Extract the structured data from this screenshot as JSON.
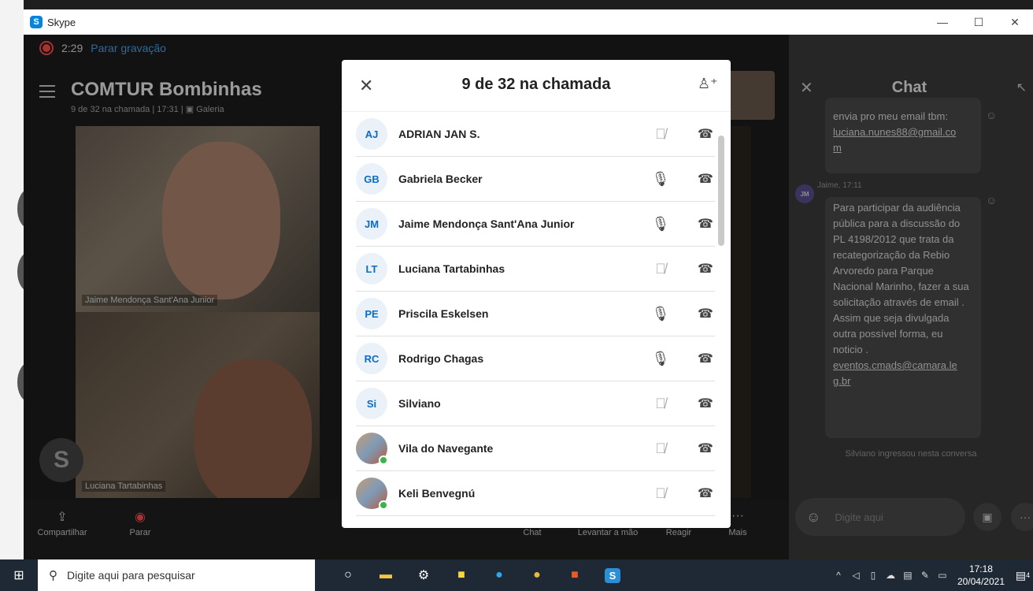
{
  "window": {
    "app_title": "Skype"
  },
  "recording": {
    "time": "2:29",
    "stop_label": "Parar gravação"
  },
  "call": {
    "title": "COMTUR Bombinhas",
    "subtitle": "9 de 32 na chamada | 17:31 | ▣ Galeria",
    "video_labels": [
      "Jaime Mendonça Sant'Ana Junior",
      "Luciana Tartabinhas"
    ],
    "controls": [
      {
        "label": "Compartilhar",
        "icon": "share-icon"
      },
      {
        "label": "Parar",
        "icon": "record-stop-icon"
      },
      {
        "label": "Chat",
        "icon": "chat-icon"
      },
      {
        "label": "Levantar a mão",
        "icon": "hand-icon"
      },
      {
        "label": "Reagir",
        "icon": "react-icon"
      },
      {
        "label": "Mais",
        "icon": "more-icon"
      }
    ]
  },
  "modal": {
    "title": "9 de 32 na chamada",
    "participants": [
      {
        "initials": "AJ",
        "name": "ADRIAN JAN S.",
        "muted": true,
        "photo": false,
        "online": false
      },
      {
        "initials": "GB",
        "name": "Gabriela Becker",
        "muted": false,
        "photo": false,
        "online": false
      },
      {
        "initials": "JM",
        "name": "Jaime Mendonça Sant'Ana Junior",
        "muted": false,
        "photo": false,
        "online": false
      },
      {
        "initials": "LT",
        "name": "Luciana Tartabinhas",
        "muted": true,
        "photo": false,
        "online": false
      },
      {
        "initials": "PE",
        "name": "Priscila Eskelsen",
        "muted": false,
        "photo": false,
        "online": false
      },
      {
        "initials": "RC",
        "name": "Rodrigo Chagas",
        "muted": false,
        "photo": false,
        "online": false
      },
      {
        "initials": "Si",
        "name": "Silviano",
        "muted": true,
        "photo": false,
        "online": false
      },
      {
        "initials": "",
        "name": "Vila do Navegante",
        "muted": true,
        "photo": true,
        "online": true
      },
      {
        "initials": "",
        "name": "Keli Benvegnú",
        "muted": true,
        "photo": true,
        "online": true
      }
    ]
  },
  "chat": {
    "title": "Chat",
    "msg1_line1": "envia pro meu email tbm:",
    "msg1_link": "luciana.nunes88@gmail.co",
    "msg1_link2": "m",
    "msg2_author": "Jaime, 17:11",
    "msg2_avatar": "JM",
    "msg2_text": "Para participar da audiência pública para a discussão do PL 4198/2012 que trata da recategorização da Rebio Arvoredo para Parque Nacional Marinho, fazer a sua solicitação através de email . Assim que seja divulgada outra possível forma, eu noticio .",
    "msg2_link": "eventos.cmads@camara.le",
    "msg2_link2": "g.br",
    "system_msg": "Silviano ingressou nesta conversa",
    "input_placeholder": "Digite aqui"
  },
  "taskbar": {
    "search_placeholder": "Digite aqui para pesquisar",
    "time": "17:18",
    "date": "20/04/2021",
    "notif_count": "4"
  }
}
